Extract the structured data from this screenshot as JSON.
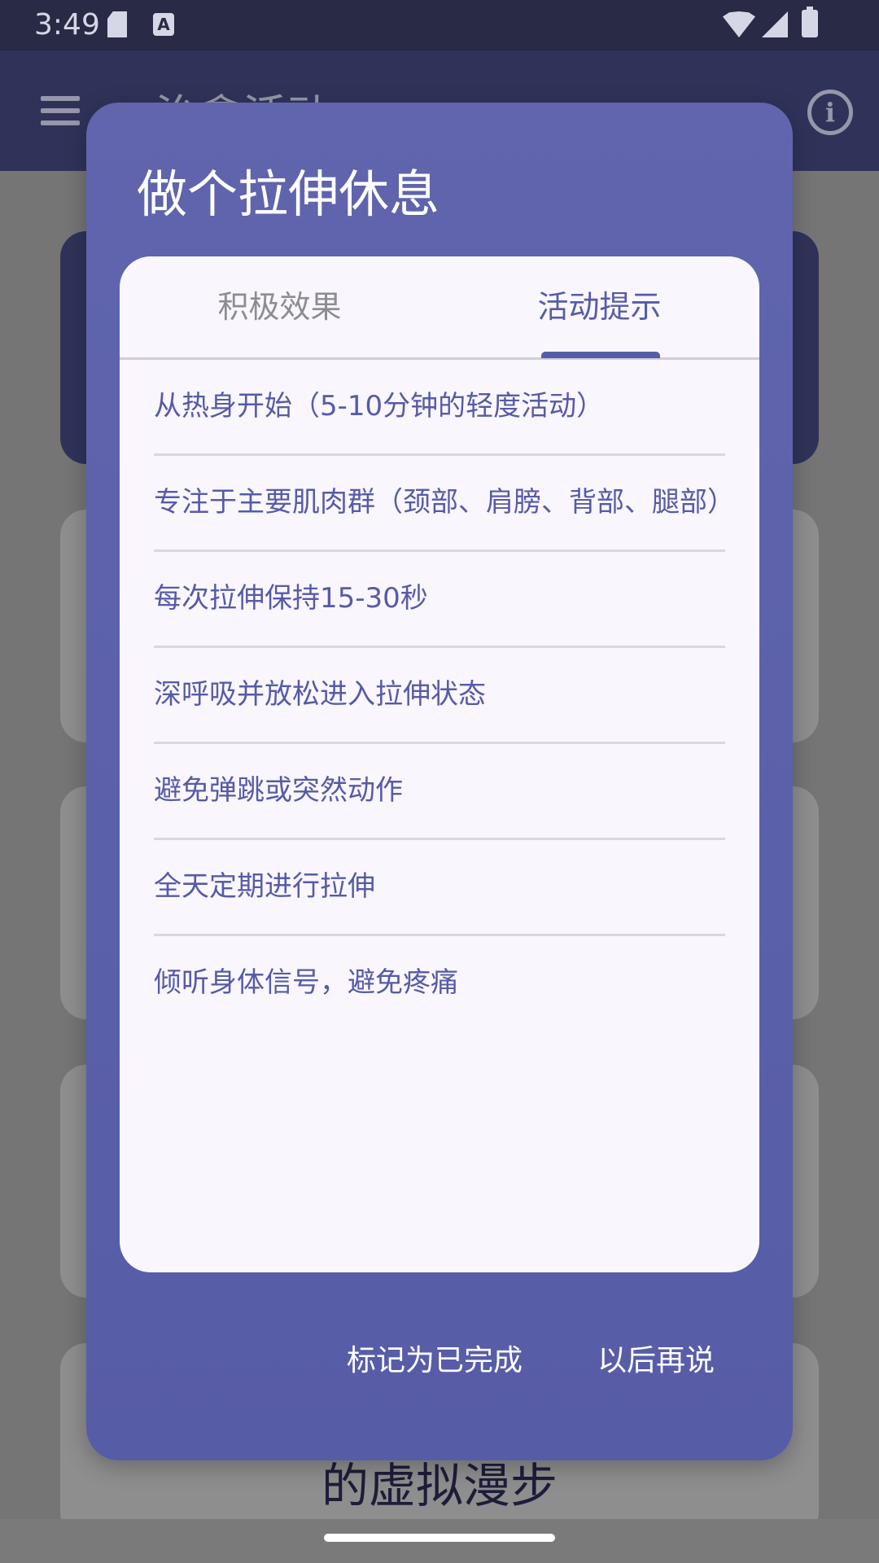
{
  "status_bar": {
    "time": "3:49",
    "keyboard_badge": "A"
  },
  "app_bar": {
    "title": "治愈活动"
  },
  "background": {
    "card_text": "的虚拟漫步"
  },
  "dialog": {
    "title": "做个拉伸休息",
    "tabs": [
      {
        "label": "积极效果",
        "selected": false
      },
      {
        "label": "活动提示",
        "selected": true
      }
    ],
    "tips": [
      "从热身开始（5-10分钟的轻度活动）",
      "专注于主要肌肉群（颈部、肩膀、背部、腿部）",
      "每次拉伸保持15-30秒",
      "深呼吸并放松进入拉伸状态",
      "避免弹跳或突然动作",
      "全天定期进行拉伸",
      "倾听身体信号，避免疼痛"
    ],
    "actions": {
      "mark_done": "标记为已完成",
      "later": "以后再说"
    }
  },
  "colors": {
    "accent": "#575ca7",
    "dialog_bg": "#5c61aa",
    "card_bg": "#f9f6fd",
    "status_bar": "#282a46"
  }
}
